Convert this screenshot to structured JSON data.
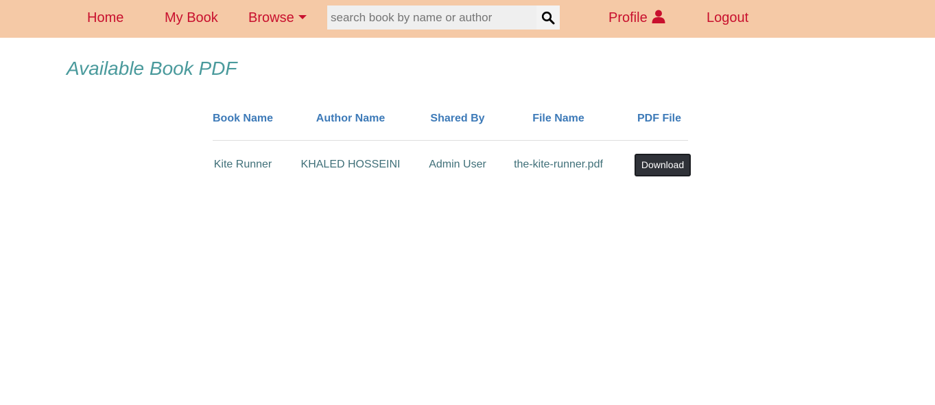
{
  "nav": {
    "home": "Home",
    "my_book": "My Book",
    "browse": "Browse",
    "profile": "Profile",
    "logout": "Logout"
  },
  "search": {
    "placeholder": "search book by name or author",
    "value": ""
  },
  "page": {
    "title": "Available Book PDF"
  },
  "table": {
    "headers": [
      "Book Name",
      "Author Name",
      "Shared By",
      "File Name",
      "PDF File"
    ],
    "rows": [
      {
        "book_name": "Kite Runner",
        "author_name": "KHALED HOSSEINI",
        "shared_by": "Admin User",
        "file_name": "the-kite-runner.pdf",
        "action_label": "Download"
      }
    ]
  },
  "colors": {
    "navbar_bg": "#f5c9a6",
    "nav_link": "#c8102e",
    "title": "#4a9a9c",
    "header_text": "#3d7ab8",
    "cell_text": "#3f6f78",
    "button_bg": "#2f3238"
  },
  "icons": {
    "browse": "caret-down-icon",
    "search": "search-icon",
    "profile": "user-icon"
  }
}
